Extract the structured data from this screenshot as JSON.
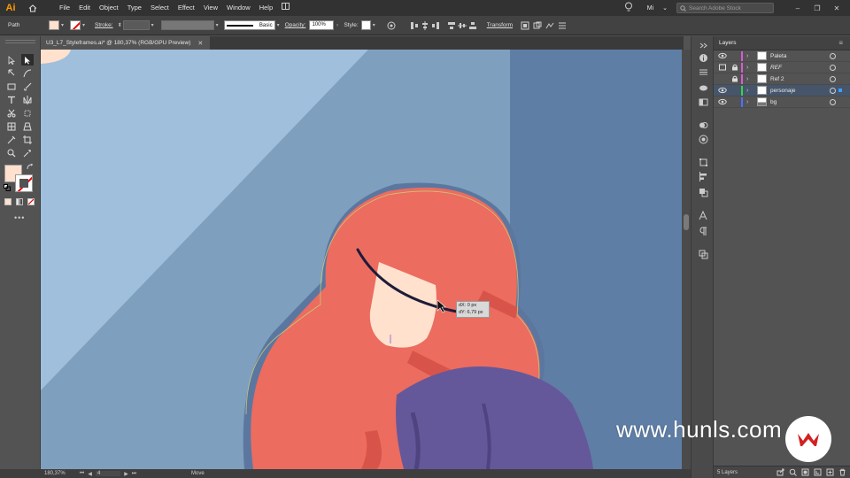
{
  "app": {
    "logo": "Ai",
    "menus": [
      "File",
      "Edit",
      "Object",
      "Type",
      "Select",
      "Effect",
      "View",
      "Window",
      "Help"
    ],
    "workspace": "Mi",
    "search_placeholder": "Search Adobe Stock"
  },
  "control_bar": {
    "selection_type": "Path",
    "stroke_label": "Stroke:",
    "brush_label": "Basic",
    "opacity_label": "Opacity:",
    "opacity_value": "100%",
    "style_label": "Style:",
    "transform_label": "Transform",
    "fill_color": "#ffe1cd"
  },
  "document": {
    "tab_title": "U3_L7_Styleframes.ai* @ 180,37% (RGB/GPU Preview)"
  },
  "status_bar": {
    "zoom": "180,37%",
    "artboard": "4",
    "current_tool": "Move"
  },
  "tooltip": {
    "dx": "dX: 0 px",
    "dy": "dY: 6,79 px"
  },
  "layers_panel": {
    "title": "Layers",
    "count_label": "5 Layers",
    "layers": [
      {
        "name": "Paleta",
        "visible": true,
        "locked": false,
        "color": "#d75ad7",
        "selected": false
      },
      {
        "name": "REF",
        "visible": false,
        "locked": true,
        "color": "#d75ad7",
        "selected": false
      },
      {
        "name": "Ref 2",
        "visible": false,
        "locked": true,
        "color": "#d75ad7",
        "selected": false
      },
      {
        "name": "personaje",
        "visible": true,
        "locked": false,
        "color": "#3ad24f",
        "selected": true
      },
      {
        "name": "bg",
        "visible": true,
        "locked": false,
        "color": "#4f6fff",
        "selected": false
      }
    ]
  },
  "watermark": {
    "text": "www.hunls.com"
  },
  "colors": {
    "canvas_light": "#a0bfdc",
    "canvas_mid": "#7f9fbe",
    "canvas_dark": "#5f7ea5",
    "hair": "#ec6c5f",
    "hair_shadow": "#d8544b",
    "skin": "#ffe1cd",
    "outfit": "#65589a",
    "path_stroke": "#1e1b3a"
  }
}
